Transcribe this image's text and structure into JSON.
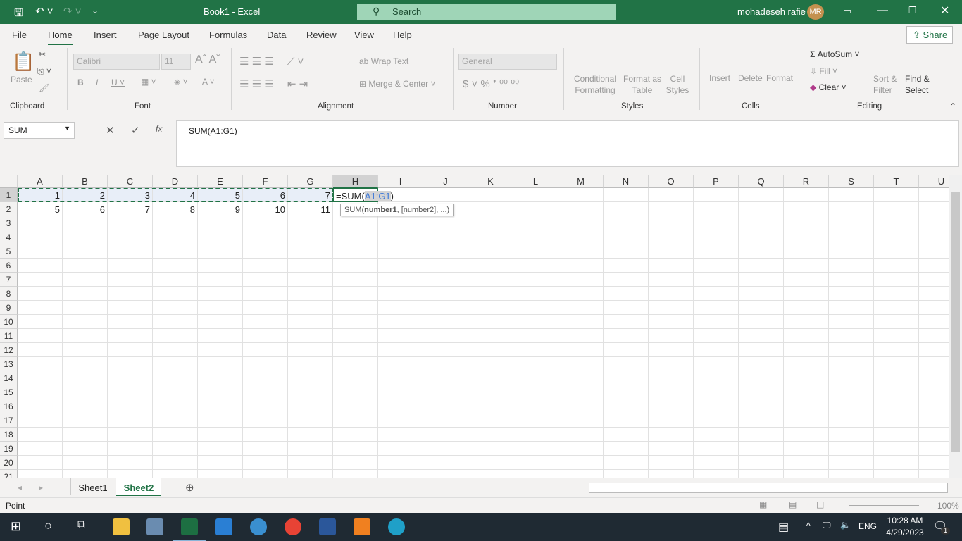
{
  "title_bar": {
    "title": "Book1  -  Excel",
    "search": "Search",
    "user": "mohadeseh rafie",
    "initials": "MR"
  },
  "tabs": [
    "File",
    "Home",
    "Insert",
    "Page Layout",
    "Formulas",
    "Data",
    "Review",
    "View",
    "Help"
  ],
  "active_tab": "Home",
  "share": "Share",
  "ribbon": {
    "clipboard": {
      "paste": "Paste",
      "label": "Clipboard"
    },
    "font": {
      "name": "Calibri",
      "size": "11",
      "label": "Font"
    },
    "alignment": {
      "wrap": "Wrap Text",
      "merge": "Merge & Center",
      "label": "Alignment"
    },
    "number": {
      "format": "General",
      "label": "Number"
    },
    "styles": {
      "cond": "Conditional Formatting",
      "table": "Format as Table",
      "cell": "Cell Styles",
      "label": "Styles"
    },
    "cells": {
      "insert": "Insert",
      "delete": "Delete",
      "format": "Format",
      "label": "Cells"
    },
    "editing": {
      "autosum": "AutoSum",
      "fill": "Fill",
      "clear": "Clear",
      "sort": "Sort & Filter",
      "find": "Find & Select",
      "label": "Editing"
    }
  },
  "formula_bar": {
    "name_box": "SUM",
    "formula": "=SUM(A1:G1)"
  },
  "sheet": {
    "columns": [
      "A",
      "B",
      "C",
      "D",
      "E",
      "F",
      "G",
      "H",
      "I",
      "J",
      "K",
      "L",
      "M",
      "N",
      "O",
      "P",
      "Q",
      "R",
      "S",
      "T",
      "U"
    ],
    "rows": [
      "1",
      "2",
      "3",
      "4",
      "5",
      "6",
      "7",
      "8",
      "9",
      "10",
      "11",
      "12",
      "13",
      "14",
      "15",
      "16",
      "17",
      "18",
      "19",
      "20",
      "21"
    ],
    "cells": [
      [
        "1",
        "2",
        "3",
        "4",
        "5",
        "6",
        "7"
      ],
      [
        "5",
        "6",
        "7",
        "8",
        "9",
        "10",
        "11"
      ]
    ],
    "edit_cell": {
      "prefix": "=SUM(",
      "ref": "A1:G1",
      "suffix": ")"
    },
    "tooltip": {
      "fn": "SUM(",
      "arg1": "number1",
      ",rest": "",
      "rest": ", [number2], ...)"
    }
  },
  "sheet_tabs": [
    "Sheet1",
    "Sheet2"
  ],
  "active_sheet": "Sheet2",
  "status": {
    "mode": "Point",
    "zoom": "100%"
  },
  "taskbar": {
    "lang": "ENG",
    "time": "10:28 AM",
    "date": "4/29/2023",
    "notifications": "1"
  }
}
